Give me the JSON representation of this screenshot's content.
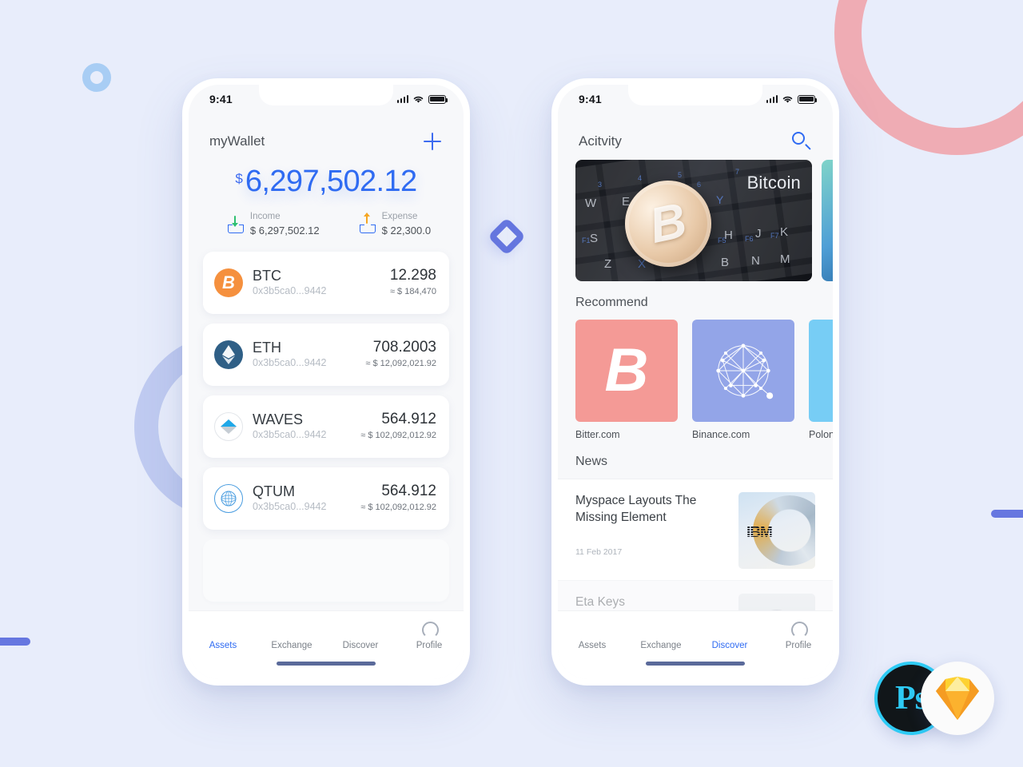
{
  "page": {
    "background_color": "#e8edfb",
    "accent_color": "#2f6bf2"
  },
  "decorations": {
    "ring_pink_color": "#efa9b0",
    "ring_blue_color": "#b9c4ef",
    "dot_ring_color": "#a8cdf4",
    "diamond_color": "#6677e0",
    "bar_color": "#6677e0"
  },
  "badges": {
    "photoshop": {
      "name": "photoshop-badge",
      "label": "Ps",
      "color": "#2ecbf5"
    },
    "sketch": {
      "name": "sketch-badge",
      "label": "Sketch gem",
      "color": "#f7a928"
    }
  },
  "phone1": {
    "statusbar": {
      "time": "9:41",
      "signal": "signal-bars",
      "wifi": "wifi-icon",
      "battery": "battery-icon"
    },
    "header": {
      "title": "myWallet",
      "add_icon": "plus-icon"
    },
    "balance": {
      "currency_symbol": "$",
      "amount": "6,297,502.12",
      "income_label": "Income",
      "income_value": "$ 6,297,502.12",
      "income_icon": "download-tray-icon",
      "expense_label": "Expense",
      "expense_value": "$ 22,300.0",
      "expense_icon": "upload-tray-icon"
    },
    "assets": [
      {
        "symbol": "BTC",
        "address": "0x3b5ca0...9442",
        "amount": "12.298",
        "fiat": "≈ $ 184,470",
        "icon": "bitcoin-coin-icon"
      },
      {
        "symbol": "ETH",
        "address": "0x3b5ca0...9442",
        "amount": "708.2003",
        "fiat": "≈ $ 12,092,021.92",
        "icon": "ethereum-coin-icon"
      },
      {
        "symbol": "WAVES",
        "address": "0x3b5ca0...9442",
        "amount": "564.912",
        "fiat": "≈ $ 102,092,012.92",
        "icon": "waves-coin-icon"
      },
      {
        "symbol": "QTUM",
        "address": "0x3b5ca0...9442",
        "amount": "564.912",
        "fiat": "≈ $ 102,092,012.92",
        "icon": "qtum-coin-icon"
      }
    ],
    "tabs": [
      {
        "label": "Assets",
        "icon": "diamond-icon",
        "active": true
      },
      {
        "label": "Exchange",
        "icon": "exchange-icon",
        "active": false
      },
      {
        "label": "Discover",
        "icon": "compass-icon",
        "active": false
      },
      {
        "label": "Profile",
        "icon": "person-icon",
        "active": false
      }
    ]
  },
  "phone2": {
    "statusbar": {
      "time": "9:41",
      "signal": "signal-bars",
      "wifi": "wifi-icon",
      "battery": "battery-icon"
    },
    "header": {
      "title": "Acitvity",
      "search_icon": "search-icon"
    },
    "banner": {
      "label": "Bitcoin",
      "image": "bitcoin-coin-on-keyboard-photo"
    },
    "recommend": {
      "section_title": "Recommend",
      "items": [
        {
          "name": "Bitter.com",
          "color": "#f49a96",
          "icon": "bitcoin-b-icon"
        },
        {
          "name": "Binance.com",
          "color": "#93a5e8",
          "icon": "network-graph-icon"
        },
        {
          "name": "Polon",
          "color": "#77cdf5",
          "icon": "exchange-logo-icon"
        }
      ]
    },
    "news": {
      "section_title": "News",
      "items": [
        {
          "title": "Myspace Layouts The Missing Element",
          "date": "11 Feb 2017",
          "thumb": "ibm-storage-photo"
        },
        {
          "title": "Eta Keys",
          "date": "",
          "thumb": "person-portrait-photo"
        }
      ]
    },
    "tabs": [
      {
        "label": "Assets",
        "icon": "diamond-icon",
        "active": false
      },
      {
        "label": "Exchange",
        "icon": "exchange-icon",
        "active": false
      },
      {
        "label": "Discover",
        "icon": "compass-icon",
        "active": true
      },
      {
        "label": "Profile",
        "icon": "person-icon",
        "active": false
      }
    ]
  }
}
